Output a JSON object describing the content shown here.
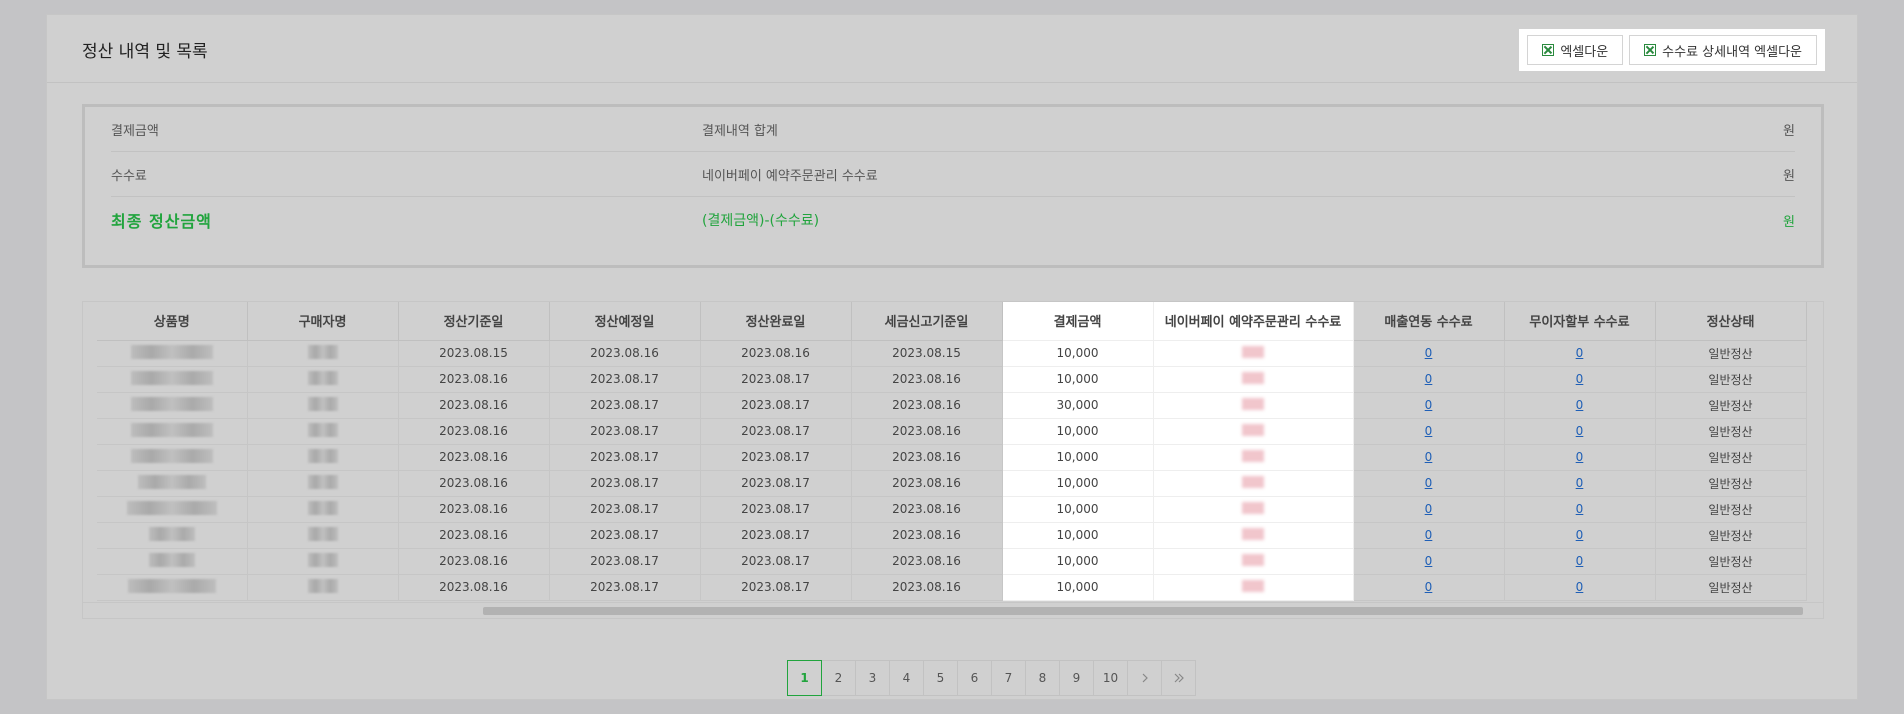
{
  "header": {
    "title": "정산 내역 및 목록",
    "excel_download_label": "엑셀다운",
    "fee_excel_download_label": "수수료 상세내역 엑셀다운"
  },
  "summary": [
    {
      "label": "결제금액",
      "desc": "결제내역 합계",
      "unit": "원"
    },
    {
      "label": "수수료",
      "desc": "네이버페이 예약주문관리 수수료",
      "unit": "원"
    },
    {
      "label": "최종 정산금액",
      "desc": "(결제금액)-(수수료)",
      "unit": "원"
    }
  ],
  "table": {
    "columns": [
      "상품명",
      "구매자명",
      "정산기준일",
      "정산예정일",
      "정산완료일",
      "세금신고기준일",
      "결제금액",
      "네이버페이 예약주문관리 수수료",
      "매출연동 수수료",
      "무이자할부 수수료",
      "정산상태"
    ],
    "rows": [
      {
        "settle_base": "2023.08.15",
        "settle_expected": "2023.08.16",
        "settle_done": "2023.08.16",
        "tax_base": "2023.08.15",
        "amount": "10,000",
        "sales_fee": "0",
        "installment_fee": "0",
        "status": "일반정산"
      },
      {
        "settle_base": "2023.08.16",
        "settle_expected": "2023.08.17",
        "settle_done": "2023.08.17",
        "tax_base": "2023.08.16",
        "amount": "10,000",
        "sales_fee": "0",
        "installment_fee": "0",
        "status": "일반정산"
      },
      {
        "settle_base": "2023.08.16",
        "settle_expected": "2023.08.17",
        "settle_done": "2023.08.17",
        "tax_base": "2023.08.16",
        "amount": "30,000",
        "sales_fee": "0",
        "installment_fee": "0",
        "status": "일반정산"
      },
      {
        "settle_base": "2023.08.16",
        "settle_expected": "2023.08.17",
        "settle_done": "2023.08.17",
        "tax_base": "2023.08.16",
        "amount": "10,000",
        "sales_fee": "0",
        "installment_fee": "0",
        "status": "일반정산"
      },
      {
        "settle_base": "2023.08.16",
        "settle_expected": "2023.08.17",
        "settle_done": "2023.08.17",
        "tax_base": "2023.08.16",
        "amount": "10,000",
        "sales_fee": "0",
        "installment_fee": "0",
        "status": "일반정산"
      },
      {
        "settle_base": "2023.08.16",
        "settle_expected": "2023.08.17",
        "settle_done": "2023.08.17",
        "tax_base": "2023.08.16",
        "amount": "10,000",
        "sales_fee": "0",
        "installment_fee": "0",
        "status": "일반정산"
      },
      {
        "settle_base": "2023.08.16",
        "settle_expected": "2023.08.17",
        "settle_done": "2023.08.17",
        "tax_base": "2023.08.16",
        "amount": "10,000",
        "sales_fee": "0",
        "installment_fee": "0",
        "status": "일반정산"
      },
      {
        "settle_base": "2023.08.16",
        "settle_expected": "2023.08.17",
        "settle_done": "2023.08.17",
        "tax_base": "2023.08.16",
        "amount": "10,000",
        "sales_fee": "0",
        "installment_fee": "0",
        "status": "일반정산"
      },
      {
        "settle_base": "2023.08.16",
        "settle_expected": "2023.08.17",
        "settle_done": "2023.08.17",
        "tax_base": "2023.08.16",
        "amount": "10,000",
        "sales_fee": "0",
        "installment_fee": "0",
        "status": "일반정산"
      },
      {
        "settle_base": "2023.08.16",
        "settle_expected": "2023.08.17",
        "settle_done": "2023.08.17",
        "tax_base": "2023.08.16",
        "amount": "10,000",
        "sales_fee": "0",
        "installment_fee": "0",
        "status": "일반정산"
      }
    ]
  },
  "pagination": {
    "pages": [
      "1",
      "2",
      "3",
      "4",
      "5",
      "6",
      "7",
      "8",
      "9",
      "10"
    ],
    "current": "1",
    "next_icon": "chevron-right-icon",
    "last_icon": "double-chevron-right-icon"
  },
  "colors": {
    "accent_green": "#21a43d",
    "link_blue": "#1f5fb6",
    "excel_icon": "#2a8a3e"
  }
}
